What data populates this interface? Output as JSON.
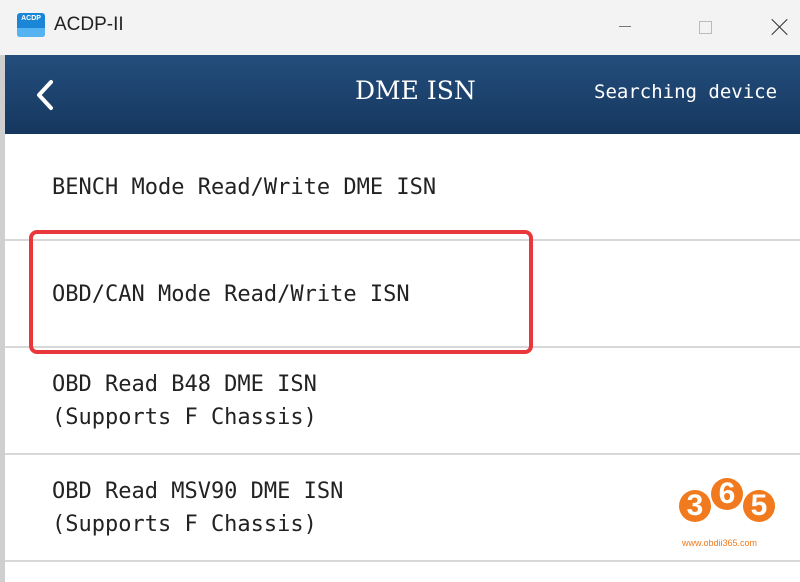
{
  "window": {
    "logo_text": "ACDP",
    "title": "ACDP-II"
  },
  "header": {
    "title": "DME ISN",
    "status": "Searching device"
  },
  "menu": {
    "items": [
      {
        "lines": [
          "BENCH Mode Read/Write DME ISN"
        ]
      },
      {
        "lines": [
          "OBD/CAN Mode Read/Write ISN"
        ]
      },
      {
        "lines": [
          "OBD Read B48 DME ISN",
          "(Supports F Chassis)"
        ]
      },
      {
        "lines": [
          "OBD Read MSV90 DME ISN",
          "(Supports F Chassis)"
        ]
      }
    ],
    "highlighted_index": 1,
    "highlight_color": "#e8383b"
  },
  "watermark": {
    "digits": [
      "3",
      "6",
      "5"
    ],
    "url": "www.obdii365.com",
    "color": "#f07a1d"
  },
  "colors": {
    "header_bg": "#1c426d",
    "titlebar_bg": "#f3f3f3"
  }
}
